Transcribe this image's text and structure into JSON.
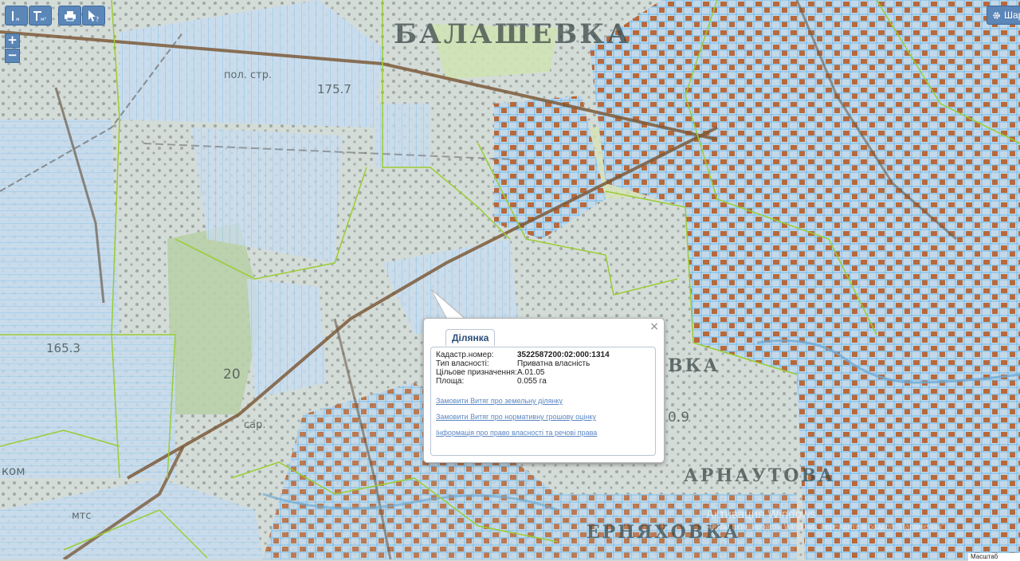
{
  "map": {
    "place_labels": [
      {
        "id": "balashevka",
        "text": "БАЛАШЕВКА"
      },
      {
        "id": "arnautova",
        "text": "АРНАУТОВА"
      },
      {
        "id": "chernyakhovka",
        "text": "ЕРНЯХОВКА"
      },
      {
        "id": "vka",
        "text": "ВКА"
      }
    ],
    "height_labels": [
      "175.7",
      "165.3",
      "20",
      "0.9",
      "сар.",
      "пол. стр.",
      "ком",
      "мтс"
    ]
  },
  "toolbar": {
    "measure_length_icon": "ruler-length-icon",
    "measure_area_icon": "ruler-area-icon",
    "print_icon": "print-icon",
    "identify_icon": "cursor-question-icon"
  },
  "zoom": {
    "in": "+",
    "out": "−"
  },
  "settings": {
    "label": "Шар",
    "icon": "gear-icon"
  },
  "popup": {
    "tab_label": "Ділянка",
    "close_symbol": "×",
    "attributes": [
      {
        "key": "Кадастр.номер:",
        "value": "3522587200:02:000:1314"
      },
      {
        "key": "Тип власності:",
        "value": "Приватна власність"
      },
      {
        "key": "Цільове призначення:",
        "value": "A.01.05"
      },
      {
        "key": "Площа:",
        "value": "0.055 га"
      }
    ],
    "links": [
      "Замовити Витяг про земельну ділянку",
      "Замовити Витяг про нормативну грошову оцінку",
      "Інформація про право власності та речові права"
    ]
  },
  "watermark": {
    "title": "Активация Windows",
    "subtitle": "Чтобы активировать Windows, перейдите в раздел \"Параметры\"."
  },
  "scale": {
    "label": "Масштаб"
  },
  "colors": {
    "parcel": "#7ec3ee",
    "boundary": "#9acd32",
    "building": "#b8683a",
    "button": "#5b86b8"
  }
}
